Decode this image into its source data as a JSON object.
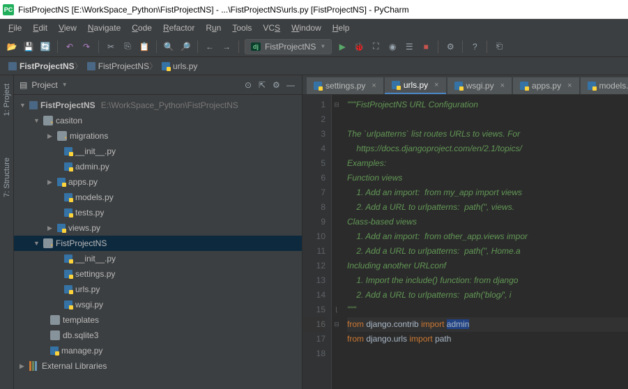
{
  "title": "FistProjectNS [E:\\WorkSpace_Python\\FistProjectNS] - ...\\FistProjectNS\\urls.py [FistProjectNS] - PyCharm",
  "menu": [
    "File",
    "Edit",
    "View",
    "Navigate",
    "Code",
    "Refactor",
    "Run",
    "Tools",
    "VCS",
    "Window",
    "Help"
  ],
  "run_config": "FistProjectNS",
  "breadcrumb": {
    "root": "FistProjectNS",
    "folder": "FistProjectNS",
    "file": "urls.py"
  },
  "panel": {
    "title": "Project"
  },
  "sidebar": {
    "project": "1: Project",
    "structure": "7: Structure"
  },
  "tree": {
    "root": {
      "name": "FistProjectNS",
      "path": "E:\\WorkSpace_Python\\FistProjectNS"
    },
    "casiton": "casiton",
    "migrations": "migrations",
    "init": "__init__.py",
    "admin": "admin.py",
    "apps": "apps.py",
    "models": "models.py",
    "tests": "tests.py",
    "views": "views.py",
    "fist": "FistProjectNS",
    "init2": "__init__.py",
    "settings": "settings.py",
    "urls": "urls.py",
    "wsgi": "wsgi.py",
    "templates": "templates",
    "db": "db.sqlite3",
    "manage": "manage.py",
    "ext": "External Libraries"
  },
  "tabs": [
    "settings.py",
    "urls.py",
    "wsgi.py",
    "apps.py",
    "models."
  ],
  "active_tab": 1,
  "code": {
    "lines": [
      {
        "n": 1,
        "cls": "docstr",
        "text": "\"\"\"FistProjectNS URL Configuration"
      },
      {
        "n": 2,
        "cls": "docstr",
        "text": ""
      },
      {
        "n": 3,
        "cls": "docstr",
        "text": "The `urlpatterns` list routes URLs to views. For "
      },
      {
        "n": 4,
        "cls": "docstr",
        "text": "    https://docs.djangoproject.com/en/2.1/topics/"
      },
      {
        "n": 5,
        "cls": "docstr",
        "text": "Examples:"
      },
      {
        "n": 6,
        "cls": "docstr",
        "text": "Function views"
      },
      {
        "n": 7,
        "cls": "docstr",
        "text": "    1. Add an import:  from my_app import views"
      },
      {
        "n": 8,
        "cls": "docstr",
        "text": "    2. Add a URL to urlpatterns:  path('', views."
      },
      {
        "n": 9,
        "cls": "docstr",
        "text": "Class-based views"
      },
      {
        "n": 10,
        "cls": "docstr",
        "text": "    1. Add an import:  from other_app.views impor"
      },
      {
        "n": 11,
        "cls": "docstr",
        "text": "    2. Add a URL to urlpatterns:  path('', Home.a"
      },
      {
        "n": 12,
        "cls": "docstr",
        "text": "Including another URLconf"
      },
      {
        "n": 13,
        "cls": "docstr",
        "text": "    1. Import the include() function: from django"
      },
      {
        "n": 14,
        "cls": "docstr",
        "text": "    2. Add a URL to urlpatterns:  path('blog/', i"
      },
      {
        "n": 15,
        "cls": "docstr",
        "text": "\"\"\""
      }
    ],
    "line16": {
      "from": "from ",
      "mod": "django.contrib ",
      "imp": "import ",
      "name": "admin"
    },
    "line17": {
      "from": "from ",
      "mod": "django.urls ",
      "imp": "import ",
      "name": "path"
    }
  }
}
